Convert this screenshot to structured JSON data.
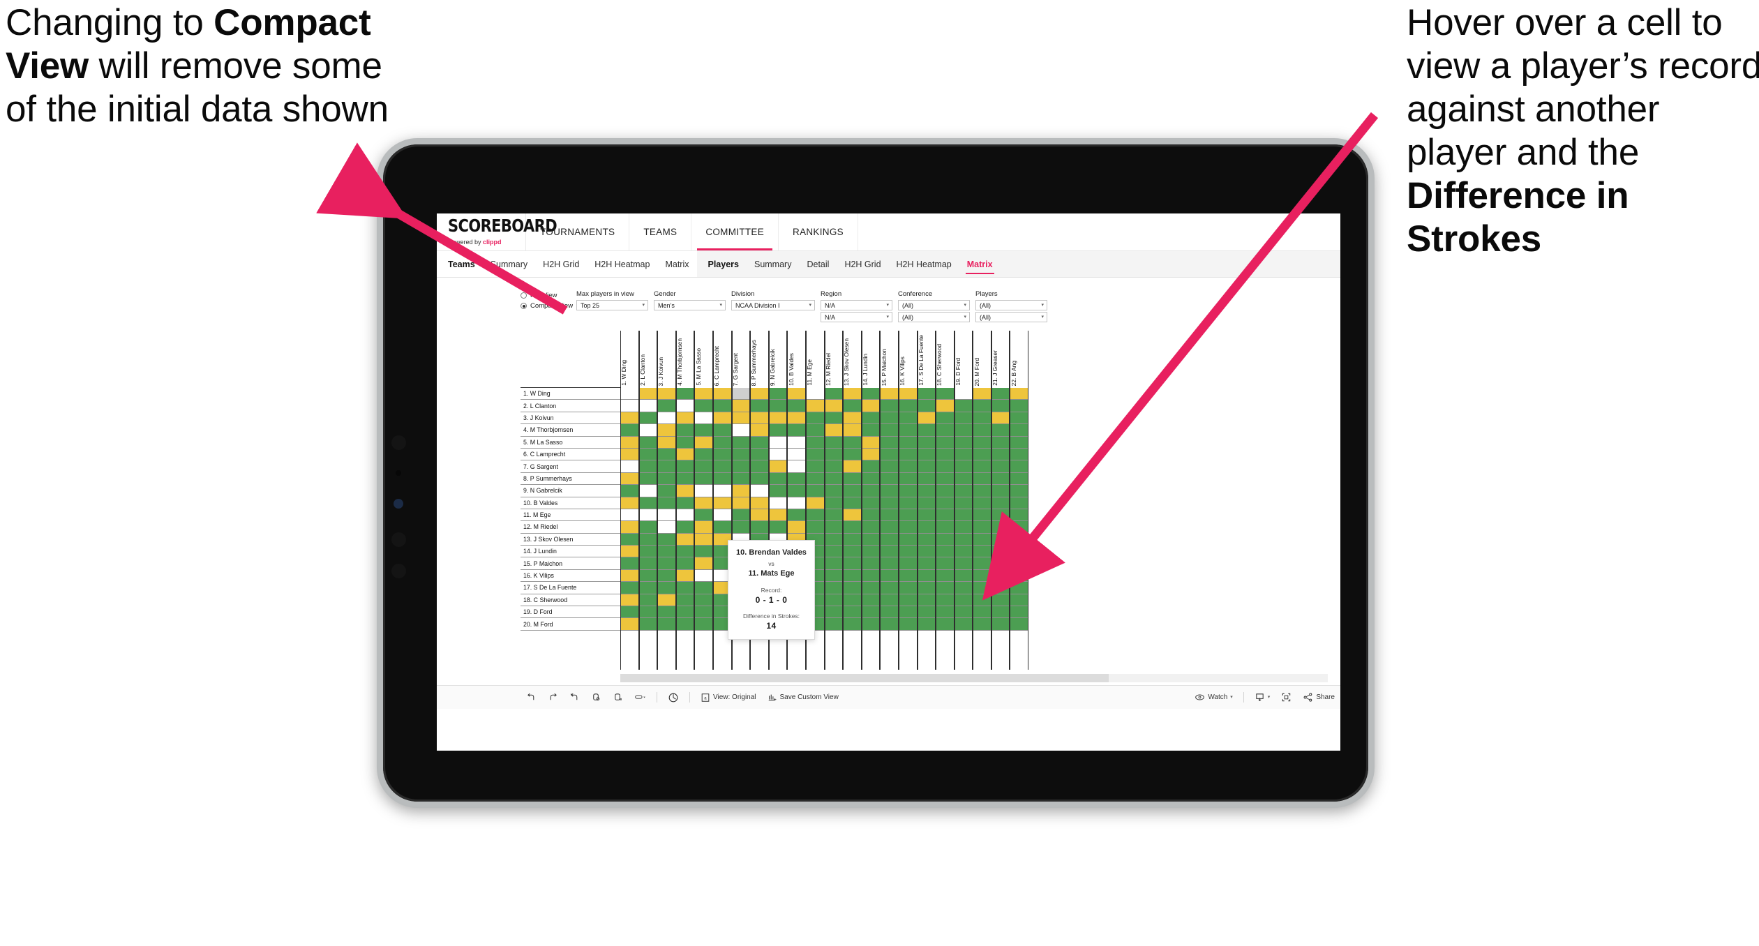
{
  "annotations": {
    "left": {
      "pre": "Changing to ",
      "bold": "Compact View",
      "post": " will remove some of the initial data shown"
    },
    "right": {
      "pre": "Hover over a cell to view a player’s record against another player and the ",
      "bold": "Difference in Strokes",
      "post": ""
    }
  },
  "app": {
    "logo": {
      "main": "SCOREBOARD",
      "sub_pre": "Powered by ",
      "sub_brand": "clippd"
    },
    "top_nav": [
      {
        "label": "TOURNAMENTS",
        "active": false
      },
      {
        "label": "TEAMS",
        "active": false
      },
      {
        "label": "COMMITTEE",
        "active": true
      },
      {
        "label": "RANKINGS",
        "active": false
      }
    ],
    "sub_nav_group_1": {
      "title": "Teams",
      "items": [
        {
          "label": "Summary",
          "active": false
        },
        {
          "label": "H2H Grid",
          "active": false
        },
        {
          "label": "H2H Heatmap",
          "active": false
        },
        {
          "label": "Matrix",
          "active": false
        }
      ]
    },
    "sub_nav_group_2": {
      "title": "Players",
      "items": [
        {
          "label": "Summary",
          "active": false
        },
        {
          "label": "Detail",
          "active": false
        },
        {
          "label": "H2H Grid",
          "active": false
        },
        {
          "label": "H2H Heatmap",
          "active": false
        },
        {
          "label": "Matrix",
          "active": true
        }
      ]
    }
  },
  "filters": {
    "view_options": [
      {
        "label": "Full View",
        "selected": false
      },
      {
        "label": "Compact View",
        "selected": true
      }
    ],
    "dropdowns": [
      {
        "label": "Max players in view",
        "values": [
          "Top 25"
        ]
      },
      {
        "label": "Gender",
        "values": [
          "Men’s"
        ]
      },
      {
        "label": "Division",
        "values": [
          "NCAA Division I"
        ]
      },
      {
        "label": "Region",
        "values": [
          "N/A",
          "N/A"
        ]
      },
      {
        "label": "Conference",
        "values": [
          "(All)",
          "(All)"
        ]
      },
      {
        "label": "Players",
        "values": [
          "(All)",
          "(All)"
        ]
      }
    ]
  },
  "matrix": {
    "row_labels": [
      "1. W Ding",
      "2. L Clanton",
      "3. J Koivun",
      "4. M Thorbjornsen",
      "5. M La Sasso",
      "6. C Lamprecht",
      "7. G Sargent",
      "8. P Summerhays",
      "9. N Gabrelcik",
      "10. B Valdes",
      "11. M Ege",
      "12. M Riedel",
      "13. J Skov Olesen",
      "14. J Lundin",
      "15. P Maichon",
      "16. K Vilips",
      "17. S De La Fuente",
      "18. C Sherwood",
      "19. D Ford",
      "20. M Ford"
    ],
    "col_labels": [
      "1. W Ding",
      "2. L Clanton",
      "3. J Koivun",
      "4. M Thorbjornsen",
      "5. M La Sasso",
      "6. C Lamprecht",
      "7. G Sargent",
      "8. P Summerhays",
      "9. N Gabrelcik",
      "10. B Valdes",
      "11. M Ege",
      "12. M Riedel",
      "13. J Skov Olesen",
      "14. J Lundin",
      "15. P Maichon",
      "16. K Vilips",
      "17. S De La Fuente",
      "18. C Sherwood",
      "19. D Ford",
      "20. M Ford",
      "21. J Greaser",
      "22. B Ang"
    ],
    "legend_colors": {
      "win": "#4c9e52",
      "tie": "#eec53c",
      "loss": "#cfcfcf",
      "none": "#ffffff"
    },
    "cells": [
      [
        "w",
        "y",
        "y",
        "g",
        "y",
        "y",
        "n",
        "y",
        "g",
        "y",
        "w",
        "g",
        "y",
        "g",
        "y",
        "y",
        "g",
        "g",
        "w",
        "y",
        "g",
        "y"
      ],
      [
        "w",
        "w",
        "g",
        "w",
        "g",
        "g",
        "y",
        "g",
        "g",
        "g",
        "y",
        "y",
        "g",
        "y",
        "g",
        "g",
        "g",
        "y",
        "g",
        "g",
        "g",
        "g"
      ],
      [
        "y",
        "g",
        "w",
        "y",
        "w",
        "y",
        "y",
        "y",
        "y",
        "y",
        "g",
        "g",
        "y",
        "g",
        "g",
        "g",
        "y",
        "g",
        "g",
        "g",
        "y",
        "g"
      ],
      [
        "g",
        "w",
        "y",
        "g",
        "g",
        "g",
        "w",
        "y",
        "g",
        "g",
        "g",
        "y",
        "y",
        "g",
        "g",
        "g",
        "g",
        "g",
        "g",
        "g",
        "g",
        "g"
      ],
      [
        "y",
        "g",
        "y",
        "g",
        "y",
        "g",
        "g",
        "g",
        "w",
        "w",
        "g",
        "g",
        "g",
        "y",
        "g",
        "g",
        "g",
        "g",
        "g",
        "g",
        "g",
        "g"
      ],
      [
        "y",
        "g",
        "g",
        "y",
        "g",
        "g",
        "g",
        "g",
        "w",
        "w",
        "g",
        "g",
        "g",
        "y",
        "g",
        "g",
        "g",
        "g",
        "g",
        "g",
        "g",
        "g"
      ],
      [
        "w",
        "g",
        "g",
        "g",
        "g",
        "g",
        "g",
        "g",
        "y",
        "w",
        "g",
        "g",
        "y",
        "g",
        "g",
        "g",
        "g",
        "g",
        "g",
        "g",
        "g",
        "g"
      ],
      [
        "y",
        "g",
        "g",
        "g",
        "g",
        "g",
        "g",
        "g",
        "g",
        "g",
        "g",
        "g",
        "g",
        "g",
        "g",
        "g",
        "g",
        "g",
        "g",
        "g",
        "g",
        "g"
      ],
      [
        "g",
        "w",
        "g",
        "y",
        "w",
        "w",
        "y",
        "w",
        "g",
        "g",
        "g",
        "g",
        "g",
        "g",
        "g",
        "g",
        "g",
        "g",
        "g",
        "g",
        "g",
        "g"
      ],
      [
        "y",
        "g",
        "g",
        "g",
        "y",
        "y",
        "y",
        "y",
        "w",
        "w",
        "y",
        "g",
        "g",
        "g",
        "g",
        "g",
        "g",
        "g",
        "g",
        "g",
        "g",
        "g"
      ],
      [
        "w",
        "w",
        "w",
        "w",
        "g",
        "w",
        "g",
        "y",
        "y",
        "g",
        "g",
        "g",
        "y",
        "g",
        "g",
        "g",
        "g",
        "g",
        "g",
        "g",
        "g",
        "g"
      ],
      [
        "y",
        "g",
        "w",
        "g",
        "y",
        "g",
        "g",
        "g",
        "g",
        "y",
        "g",
        "g",
        "g",
        "g",
        "g",
        "g",
        "g",
        "g",
        "g",
        "g",
        "g",
        "g"
      ],
      [
        "g",
        "g",
        "g",
        "y",
        "y",
        "y",
        "w",
        "g",
        "w",
        "y",
        "g",
        "g",
        "g",
        "g",
        "g",
        "g",
        "g",
        "g",
        "g",
        "g",
        "g",
        "g"
      ],
      [
        "y",
        "g",
        "g",
        "g",
        "g",
        "g",
        "g",
        "g",
        "g",
        "g",
        "g",
        "g",
        "g",
        "g",
        "g",
        "g",
        "g",
        "g",
        "g",
        "g",
        "g",
        "g"
      ],
      [
        "g",
        "g",
        "g",
        "g",
        "y",
        "g",
        "g",
        "y",
        "g",
        "y",
        "g",
        "g",
        "g",
        "g",
        "g",
        "g",
        "g",
        "g",
        "g",
        "g",
        "g",
        "g"
      ],
      [
        "y",
        "g",
        "g",
        "y",
        "w",
        "w",
        "g",
        "g",
        "y",
        "g",
        "g",
        "g",
        "g",
        "g",
        "g",
        "g",
        "g",
        "g",
        "g",
        "g",
        "g",
        "g"
      ],
      [
        "g",
        "g",
        "g",
        "g",
        "g",
        "y",
        "g",
        "g",
        "g",
        "g",
        "g",
        "g",
        "g",
        "g",
        "g",
        "g",
        "g",
        "g",
        "g",
        "g",
        "g",
        "g"
      ],
      [
        "y",
        "g",
        "y",
        "g",
        "g",
        "g",
        "g",
        "g",
        "g",
        "g",
        "g",
        "g",
        "g",
        "g",
        "g",
        "g",
        "g",
        "g",
        "g",
        "g",
        "g",
        "g"
      ],
      [
        "g",
        "g",
        "g",
        "g",
        "g",
        "g",
        "g",
        "g",
        "g",
        "g",
        "g",
        "g",
        "g",
        "g",
        "g",
        "g",
        "g",
        "g",
        "g",
        "g",
        "g",
        "g"
      ],
      [
        "y",
        "g",
        "g",
        "g",
        "g",
        "g",
        "g",
        "g",
        "g",
        "g",
        "g",
        "g",
        "g",
        "g",
        "g",
        "g",
        "g",
        "g",
        "g",
        "g",
        "g",
        "g"
      ]
    ]
  },
  "tooltip": {
    "player_a": "10. Brendan Valdes",
    "vs": "vs",
    "player_b": "11. Mats Ege",
    "record_label": "Record:",
    "record_value": "0 - 1 - 0",
    "strokes_label": "Difference in Strokes:",
    "strokes_value": "14"
  },
  "toolbar": {
    "icons": [
      "undo-icon",
      "redo-icon",
      "revert-icon",
      "refresh-icon",
      "pause-icon",
      "zoom-select-icon"
    ],
    "help_icon": "help-icon",
    "view_label": "View: Original",
    "save_label": "Save Custom View",
    "watch_label": "Watch",
    "download_icon": "download-icon",
    "fullscreen_icon": "fullscreen-icon",
    "share_label": "Share"
  }
}
